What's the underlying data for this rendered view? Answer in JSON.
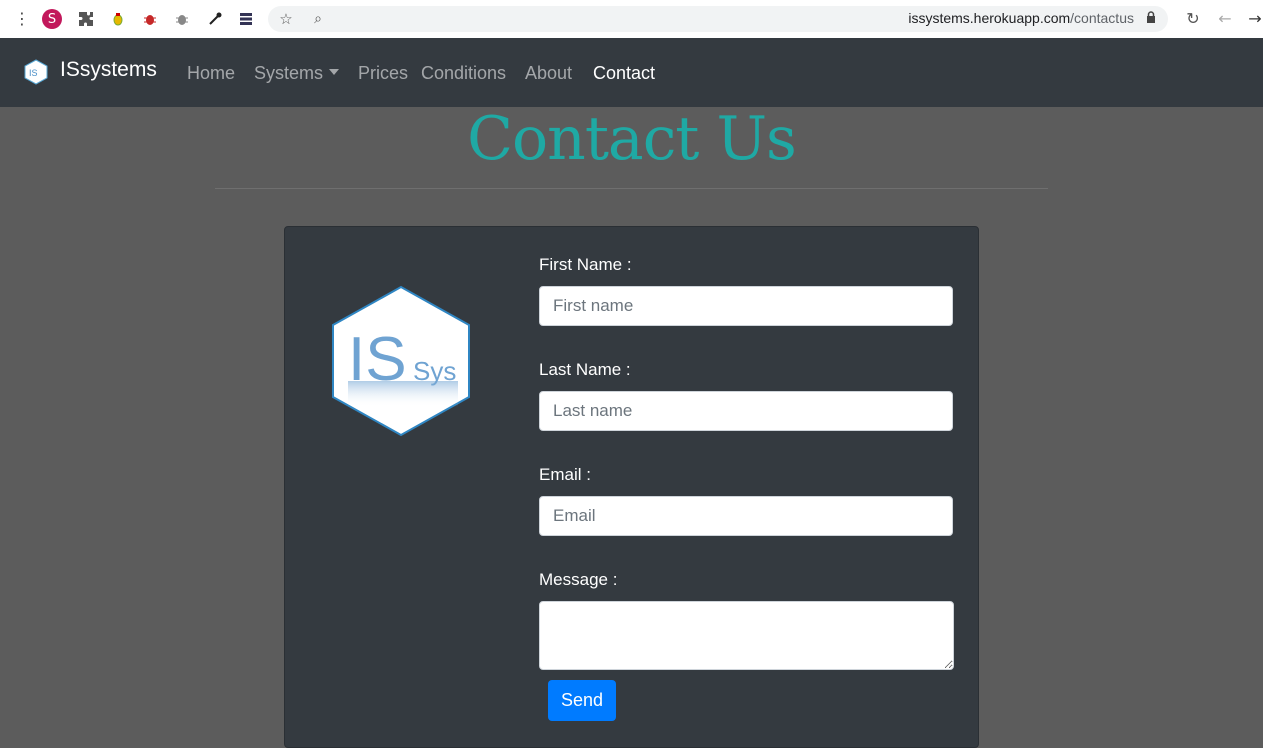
{
  "browser": {
    "extension_s_letter": "S",
    "url_domain": "issystems.herokuapp.com",
    "url_path": "/contactus",
    "icons": [
      "menu-dots-icon",
      "puzzle-icon",
      "bug-icon",
      "eyedropper-icon",
      "server-icon",
      "star-icon",
      "lens-icon",
      "lock-icon",
      "reload-icon",
      "back-icon",
      "forward-icon"
    ]
  },
  "navbar": {
    "brand": "ISsystems",
    "items": [
      {
        "label": "Home"
      },
      {
        "label": "Systems"
      },
      {
        "label": "Prices"
      },
      {
        "label": "Conditions"
      },
      {
        "label": "About"
      },
      {
        "label": "Contact"
      }
    ]
  },
  "page": {
    "title": "Contact Us"
  },
  "logo_text": {
    "big": "IS",
    "small": "Sys"
  },
  "form": {
    "first_name_label": "First Name :",
    "first_name_placeholder": "First name",
    "last_name_label": "Last Name :",
    "last_name_placeholder": "Last name",
    "email_label": "Email :",
    "email_placeholder": "Email",
    "message_label": "Message :",
    "send_label": "Send"
  },
  "colors": {
    "title_teal": "#1fa9a4",
    "navbar_bg": "#343a40",
    "page_bg": "#5c5c5c",
    "button_blue": "#007bff"
  }
}
